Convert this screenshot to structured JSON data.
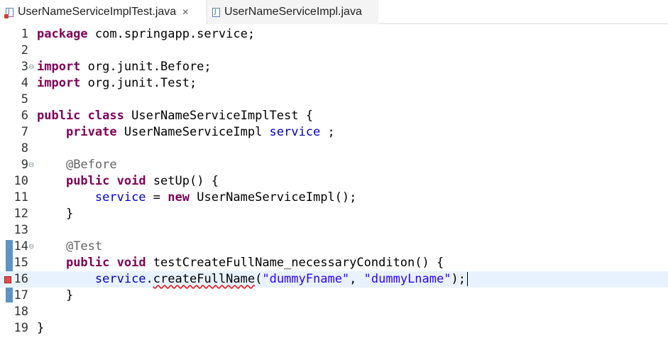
{
  "tabs": [
    {
      "label": "UserNameServiceImplTest.java",
      "close": "✕",
      "icon": "java-file-error-icon"
    },
    {
      "label": "UserNameServiceImpl.java",
      "icon": "java-file-icon"
    }
  ],
  "lines": [
    {
      "n": "1",
      "kw1": "package",
      "rest": " com.springapp.service;"
    },
    {
      "n": "2"
    },
    {
      "n": "3",
      "kw1": "import",
      "rest": " org.junit.Before;"
    },
    {
      "n": "4",
      "kw1": "import",
      "rest": " org.junit.Test;"
    },
    {
      "n": "5"
    },
    {
      "n": "6",
      "kw1": "public",
      "kw2": "class",
      "rest": " UserNameServiceImplTest {"
    },
    {
      "n": "7",
      "indent": "    ",
      "kw1": "private",
      "mid": " UserNameServiceImpl ",
      "field": "service",
      "rest": " ;"
    },
    {
      "n": "8"
    },
    {
      "n": "9",
      "indent": "    ",
      "ann": "@Before"
    },
    {
      "n": "10",
      "indent": "    ",
      "kw1": "public",
      "kw2": "void",
      "rest": " setUp() {"
    },
    {
      "n": "11",
      "indent": "        ",
      "field": "service",
      "op": " = ",
      "kw3": "new",
      "rest": " UserNameServiceImpl();"
    },
    {
      "n": "12",
      "indent": "    ",
      "rest": "}"
    },
    {
      "n": "13"
    },
    {
      "n": "14",
      "indent": "    ",
      "ann": "@Test"
    },
    {
      "n": "15",
      "indent": "    ",
      "kw1": "public",
      "kw2": "void",
      "rest": " testCreateFullName_necessaryConditon() {"
    },
    {
      "n": "16",
      "indent": "        ",
      "field": "service",
      "dot": ".",
      "call": "createFullName",
      "p1": "(",
      "s1": "\"dummyFname\"",
      "comma": ", ",
      "s2": "\"dummyLname\"",
      "end": ");"
    },
    {
      "n": "17",
      "indent": "    ",
      "rest": "}"
    },
    {
      "n": "18"
    },
    {
      "n": "19",
      "rest": "}"
    }
  ]
}
